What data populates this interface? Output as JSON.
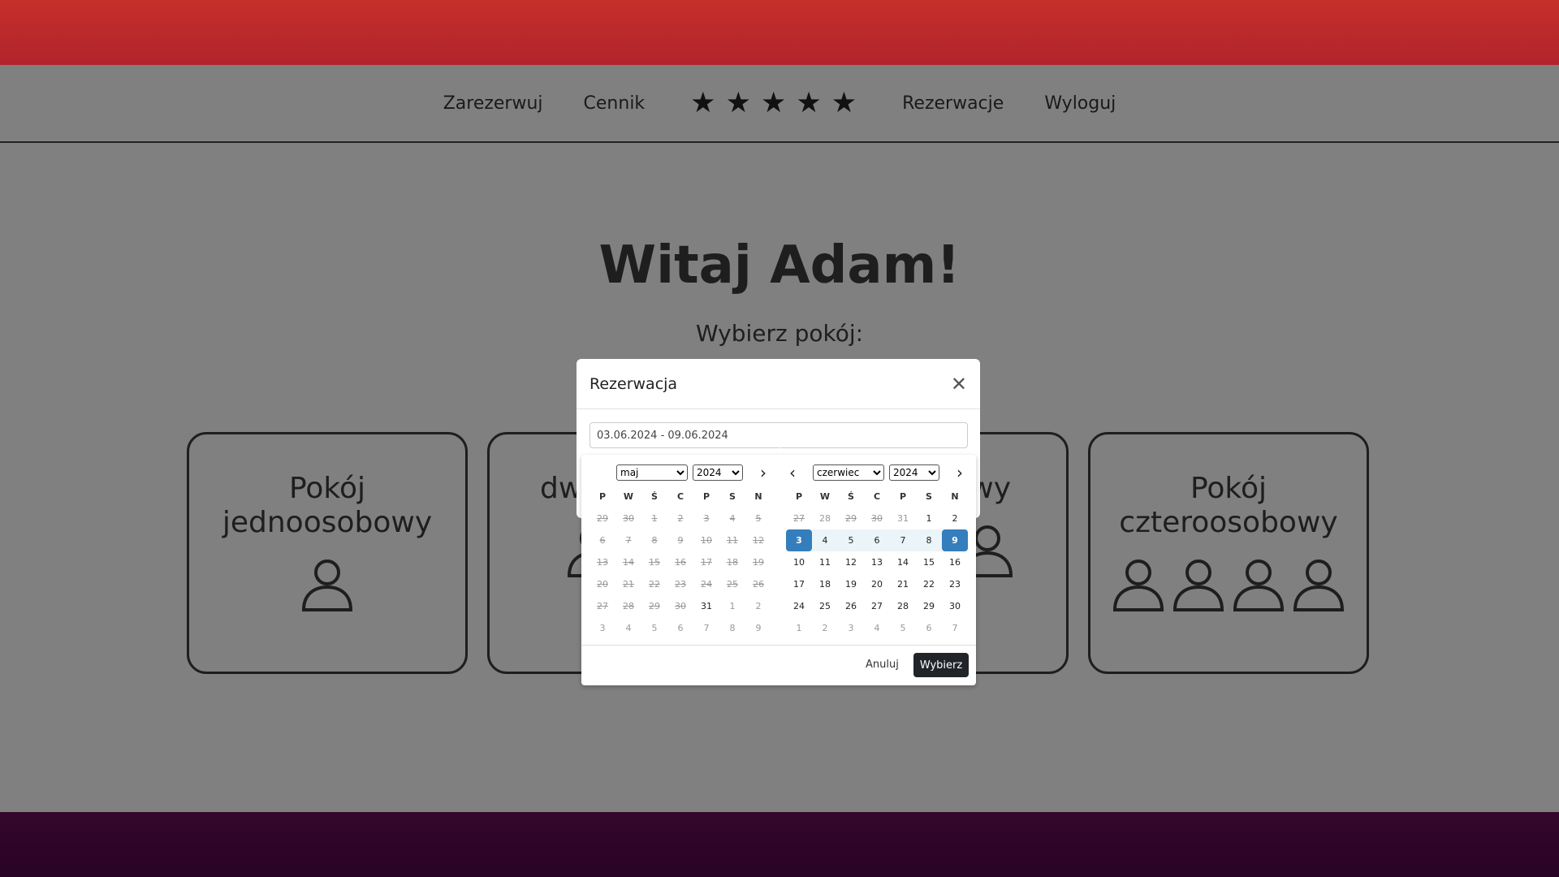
{
  "nav": {
    "items": [
      "Zarezerwuj",
      "Cennik"
    ],
    "stars_count": 5,
    "items_right": [
      "Rezerwacje",
      "Wyloguj"
    ]
  },
  "main": {
    "greeting": "Witaj Adam!",
    "subtitle": "Wybierz pokój:",
    "rooms": [
      {
        "line1": "Pokój",
        "line2": "jednoosobowy",
        "persons": 1
      },
      {
        "line1": "",
        "line2": "dw",
        "persons": 2
      },
      {
        "line1": "",
        "line2": "wy",
        "persons": 3
      },
      {
        "line1": "Pokój",
        "line2": "czteroosobowy",
        "persons": 4
      }
    ]
  },
  "modal": {
    "title": "Rezerwacja",
    "date_value": "03.06.2024 - 09.06.2024"
  },
  "picker": {
    "weekdays": [
      "P",
      "W",
      "Ś",
      "C",
      "P",
      "S",
      "N"
    ],
    "left": {
      "month": "maj",
      "year": "2024",
      "days": [
        {
          "d": "29",
          "s": "disabled"
        },
        {
          "d": "30",
          "s": "disabled"
        },
        {
          "d": "1",
          "s": "disabled"
        },
        {
          "d": "2",
          "s": "disabled"
        },
        {
          "d": "3",
          "s": "disabled"
        },
        {
          "d": "4",
          "s": "disabled"
        },
        {
          "d": "5",
          "s": "disabled"
        },
        {
          "d": "6",
          "s": "disabled"
        },
        {
          "d": "7",
          "s": "disabled"
        },
        {
          "d": "8",
          "s": "disabled"
        },
        {
          "d": "9",
          "s": "disabled"
        },
        {
          "d": "10",
          "s": "disabled"
        },
        {
          "d": "11",
          "s": "disabled"
        },
        {
          "d": "12",
          "s": "disabled"
        },
        {
          "d": "13",
          "s": "disabled"
        },
        {
          "d": "14",
          "s": "disabled"
        },
        {
          "d": "15",
          "s": "disabled"
        },
        {
          "d": "16",
          "s": "disabled"
        },
        {
          "d": "17",
          "s": "disabled"
        },
        {
          "d": "18",
          "s": "disabled"
        },
        {
          "d": "19",
          "s": "disabled"
        },
        {
          "d": "20",
          "s": "disabled"
        },
        {
          "d": "21",
          "s": "disabled"
        },
        {
          "d": "22",
          "s": "disabled"
        },
        {
          "d": "23",
          "s": "disabled"
        },
        {
          "d": "24",
          "s": "disabled"
        },
        {
          "d": "25",
          "s": "disabled"
        },
        {
          "d": "26",
          "s": "disabled"
        },
        {
          "d": "27",
          "s": "disabled"
        },
        {
          "d": "28",
          "s": "disabled"
        },
        {
          "d": "29",
          "s": "disabled"
        },
        {
          "d": "30",
          "s": "disabled"
        },
        {
          "d": "31",
          "s": ""
        },
        {
          "d": "1",
          "s": "off"
        },
        {
          "d": "2",
          "s": "off"
        },
        {
          "d": "3",
          "s": "off"
        },
        {
          "d": "4",
          "s": "off"
        },
        {
          "d": "5",
          "s": "off"
        },
        {
          "d": "6",
          "s": "off"
        },
        {
          "d": "7",
          "s": "off"
        },
        {
          "d": "8",
          "s": "off"
        },
        {
          "d": "9",
          "s": "off"
        }
      ]
    },
    "right": {
      "month": "czerwiec",
      "year": "2024",
      "days": [
        {
          "d": "27",
          "s": "disabled"
        },
        {
          "d": "28",
          "s": "off"
        },
        {
          "d": "29",
          "s": "disabled"
        },
        {
          "d": "30",
          "s": "disabled"
        },
        {
          "d": "31",
          "s": "off"
        },
        {
          "d": "1",
          "s": ""
        },
        {
          "d": "2",
          "s": ""
        },
        {
          "d": "3",
          "s": "selected"
        },
        {
          "d": "4",
          "s": "inrange"
        },
        {
          "d": "5",
          "s": "inrange"
        },
        {
          "d": "6",
          "s": "inrange"
        },
        {
          "d": "7",
          "s": "inrange"
        },
        {
          "d": "8",
          "s": "inrange"
        },
        {
          "d": "9",
          "s": "selected"
        },
        {
          "d": "10",
          "s": ""
        },
        {
          "d": "11",
          "s": ""
        },
        {
          "d": "12",
          "s": ""
        },
        {
          "d": "13",
          "s": ""
        },
        {
          "d": "14",
          "s": ""
        },
        {
          "d": "15",
          "s": ""
        },
        {
          "d": "16",
          "s": ""
        },
        {
          "d": "17",
          "s": ""
        },
        {
          "d": "18",
          "s": ""
        },
        {
          "d": "19",
          "s": ""
        },
        {
          "d": "20",
          "s": ""
        },
        {
          "d": "21",
          "s": ""
        },
        {
          "d": "22",
          "s": ""
        },
        {
          "d": "23",
          "s": ""
        },
        {
          "d": "24",
          "s": ""
        },
        {
          "d": "25",
          "s": ""
        },
        {
          "d": "26",
          "s": ""
        },
        {
          "d": "27",
          "s": ""
        },
        {
          "d": "28",
          "s": ""
        },
        {
          "d": "29",
          "s": ""
        },
        {
          "d": "30",
          "s": ""
        },
        {
          "d": "1",
          "s": "off"
        },
        {
          "d": "2",
          "s": "off"
        },
        {
          "d": "3",
          "s": "off"
        },
        {
          "d": "4",
          "s": "off"
        },
        {
          "d": "5",
          "s": "off"
        },
        {
          "d": "6",
          "s": "off"
        },
        {
          "d": "7",
          "s": "off"
        }
      ]
    },
    "cancel_label": "Anuluj",
    "apply_label": "Wybierz"
  }
}
